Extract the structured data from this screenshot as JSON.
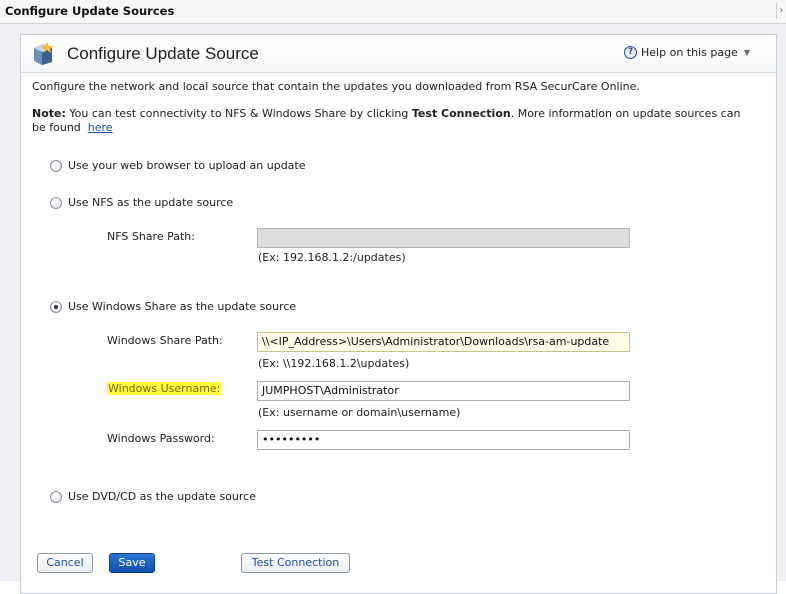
{
  "window": {
    "title": "Configure Update Sources"
  },
  "header": {
    "title": "Configure Update Source",
    "help_label": "Help on this page"
  },
  "intro": "Configure the network and local source that contain the updates you downloaded from RSA SecurCare Online.",
  "note": {
    "label": "Note:",
    "text_before": " You can test connectivity to NFS & Windows Share by clicking ",
    "test_connection": "Test Connection",
    "text_after": ". More information on update sources can be found",
    "link": "here"
  },
  "options": {
    "browser": {
      "label": "Use your web browser to upload an update",
      "checked": false
    },
    "nfs": {
      "label": "Use NFS as the update source",
      "checked": false,
      "path_label": "NFS Share Path:",
      "path_value": "",
      "path_hint": "(Ex: 192.168.1.2:/updates)"
    },
    "windows": {
      "label": "Use Windows Share as the update source",
      "checked": true,
      "path_label": "Windows Share Path:",
      "path_value": "\\\\<IP_Address>\\Users\\Administrator\\Downloads\\rsa-am-update",
      "path_hint": "(Ex: \\\\192.168.1.2\\updates)",
      "username_label": "Windows Username:",
      "username_value": "JUMPHOST\\Administrator",
      "username_hint": "(Ex: username or domain\\username)",
      "password_label": "Windows Password:",
      "password_value": "•••••••••"
    },
    "dvd": {
      "label": "Use DVD/CD as the update source",
      "checked": false
    }
  },
  "buttons": {
    "cancel": "Cancel",
    "save": "Save",
    "test_connection": "Test Connection"
  },
  "colors": {
    "highlight": "#fffd3a",
    "primary": "#0f4fb0",
    "link": "#1f4fa8"
  }
}
